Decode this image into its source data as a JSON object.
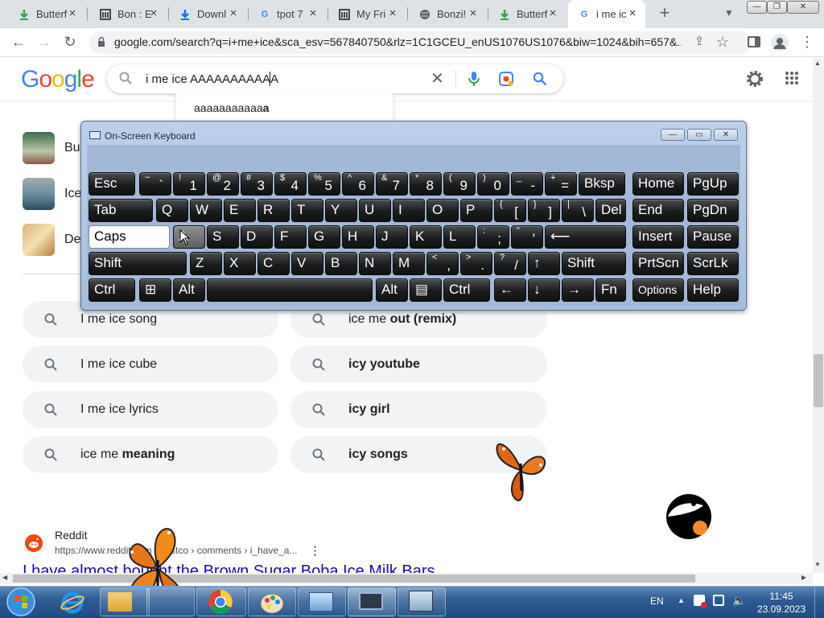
{
  "browser": {
    "tabs": [
      {
        "title": "Butterf",
        "icon": "download-green-icon"
      },
      {
        "title": "Bon : E",
        "icon": "museum-icon"
      },
      {
        "title": "Downl",
        "icon": "download-blue-icon"
      },
      {
        "title": "tpot 7",
        "icon": "google-icon"
      },
      {
        "title": "My Fri",
        "icon": "museum-icon"
      },
      {
        "title": "Bonzi!",
        "icon": "globe-icon"
      },
      {
        "title": "Butterf",
        "icon": "download-green-icon"
      },
      {
        "title": "i me ic",
        "icon": "google-icon",
        "active": true
      }
    ],
    "url": "google.com/search?q=i+me+ice&sca_esv=567840750&rlz=1C1GCEU_enUS1076US1076&biw=1024&bih=657&..."
  },
  "google": {
    "logo": "Google",
    "query": "i me ice AAAAAAAAAAA",
    "suggestion_prefix": "aaaaaaaaaaa",
    "suggestion_bold": "a"
  },
  "side_items": [
    "Bu",
    "Ice",
    "De"
  ],
  "related": [
    {
      "plain": "I me ice song",
      "bold": ""
    },
    {
      "plain": "ice me ",
      "bold": "out (remix)"
    },
    {
      "plain": "I me ice cube",
      "bold": ""
    },
    {
      "plain": "",
      "bold": "icy youtube"
    },
    {
      "plain": "I me ice lyrics",
      "bold": ""
    },
    {
      "plain": "",
      "bold": "icy girl"
    },
    {
      "plain": "ice me ",
      "bold": "meaning"
    },
    {
      "plain": "",
      "bold": "icy songs"
    }
  ],
  "result": {
    "site": "Reddit",
    "url": "https://www.reddit.com › costco › comments › i_have_a...",
    "title": "I have almost bought the Brown Sugar Boba Ice Milk Bars..."
  },
  "osk": {
    "title": "On-Screen Keyboard",
    "rows": [
      [
        {
          "l": "Esc"
        },
        {
          "t": "~",
          "b": "`"
        },
        {
          "t": "!",
          "b": "1"
        },
        {
          "t": "@",
          "b": "2"
        },
        {
          "t": "#",
          "b": "3"
        },
        {
          "t": "$",
          "b": "4"
        },
        {
          "t": "%",
          "b": "5"
        },
        {
          "t": "^",
          "b": "6"
        },
        {
          "t": "&",
          "b": "7"
        },
        {
          "t": "*",
          "b": "8"
        },
        {
          "t": "(",
          "b": "9"
        },
        {
          "t": ")",
          "b": "0"
        },
        {
          "t": "_",
          "b": "-"
        },
        {
          "t": "+",
          "b": "="
        },
        {
          "l": "Bksp"
        },
        {
          "l": "Home"
        },
        {
          "l": "PgUp"
        }
      ],
      [
        {
          "l": "Tab"
        },
        {
          "l": "Q"
        },
        {
          "l": "W"
        },
        {
          "l": "E"
        },
        {
          "l": "R"
        },
        {
          "l": "T"
        },
        {
          "l": "Y"
        },
        {
          "l": "U"
        },
        {
          "l": "I"
        },
        {
          "l": "O"
        },
        {
          "l": "P"
        },
        {
          "t": "{",
          "b": "["
        },
        {
          "t": "}",
          "b": "]"
        },
        {
          "t": "|",
          "b": "\\"
        },
        {
          "l": "Del"
        },
        {
          "l": "End"
        },
        {
          "l": "PgDn"
        }
      ],
      [
        {
          "l": "Caps"
        },
        {
          "l": "A"
        },
        {
          "l": "S"
        },
        {
          "l": "D"
        },
        {
          "l": "F"
        },
        {
          "l": "G"
        },
        {
          "l": "H"
        },
        {
          "l": "J"
        },
        {
          "l": "K"
        },
        {
          "l": "L"
        },
        {
          "t": ":",
          "b": ";"
        },
        {
          "t": "\"",
          "b": "'"
        },
        {
          "l": "⟵"
        },
        {
          "l": "Insert"
        },
        {
          "l": "Pause"
        }
      ],
      [
        {
          "l": "Shift"
        },
        {
          "l": "Z"
        },
        {
          "l": "X"
        },
        {
          "l": "C"
        },
        {
          "l": "V"
        },
        {
          "l": "B"
        },
        {
          "l": "N"
        },
        {
          "l": "M"
        },
        {
          "t": "<",
          "b": ","
        },
        {
          "t": ">",
          "b": "."
        },
        {
          "t": "?",
          "b": "/"
        },
        {
          "l": "↑"
        },
        {
          "l": "Shift"
        },
        {
          "l": "PrtScn"
        },
        {
          "l": "ScrLk"
        }
      ],
      [
        {
          "l": "Ctrl"
        },
        {
          "l": "⊞"
        },
        {
          "l": "Alt"
        },
        {
          "l": ""
        },
        {
          "l": "Alt"
        },
        {
          "l": "▤"
        },
        {
          "l": "Ctrl"
        },
        {
          "l": "←"
        },
        {
          "l": "↓"
        },
        {
          "l": "→"
        },
        {
          "l": "Fn"
        },
        {
          "l": "Options"
        },
        {
          "l": "Help"
        }
      ]
    ]
  },
  "taskbar": {
    "lang": "EN",
    "time": "11:45",
    "date": "23.09.2023",
    "apps": [
      "explorer",
      "internet-explorer",
      "folder",
      "butterfly-app",
      "chrome",
      "paint",
      "control-panel",
      "osk-app",
      "program-app"
    ]
  }
}
